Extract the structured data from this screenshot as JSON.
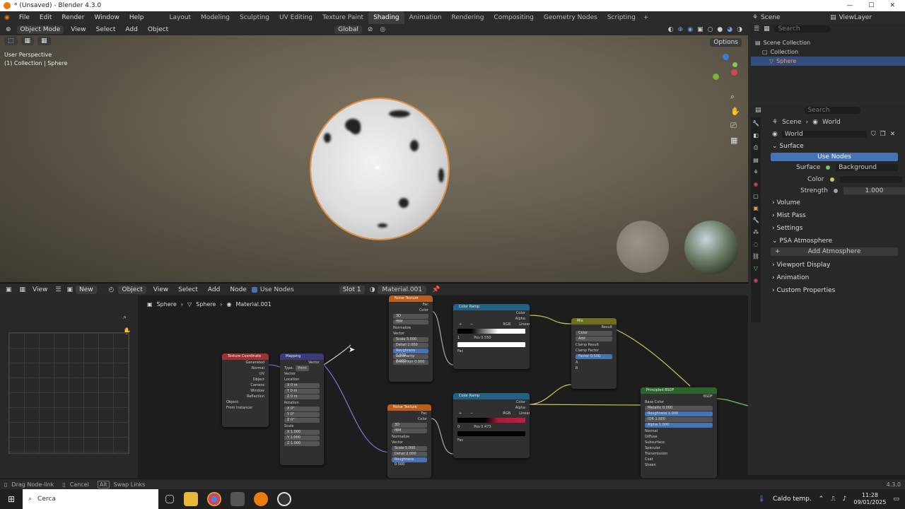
{
  "titlebar": {
    "title": "* (Unsaved) - Blender 4.3.0"
  },
  "menu": [
    "File",
    "Edit",
    "Render",
    "Window",
    "Help"
  ],
  "workspaces": [
    "Layout",
    "Modeling",
    "Sculpting",
    "UV Editing",
    "Texture Paint",
    "Shading",
    "Animation",
    "Rendering",
    "Compositing",
    "Geometry Nodes",
    "Scripting"
  ],
  "active_workspace": "Shading",
  "scene_name": "Scene",
  "view_layer": "ViewLayer",
  "viewport": {
    "mode": "Object Mode",
    "menus": [
      "View",
      "Select",
      "Add",
      "Object"
    ],
    "orientation": "Global",
    "overlay_line1": "User Perspective",
    "overlay_line2": "(1) Collection | Sphere",
    "options": "Options"
  },
  "outliner": {
    "search_placeholder": "Search",
    "items": [
      "Scene Collection",
      "Collection",
      "Sphere"
    ]
  },
  "properties": {
    "search_placeholder": "Search",
    "breadcrumb": [
      "Scene",
      "World"
    ],
    "world_name": "World",
    "surface_panel": "Surface",
    "use_nodes_label": "Use Nodes",
    "surface_label": "Surface",
    "surface_value": "Background",
    "color_label": "Color",
    "strength_label": "Strength",
    "strength_value": "1.000",
    "sections": [
      "Volume",
      "Mist Pass",
      "Settings",
      "PSA Atmosphere"
    ],
    "add_atmosphere": "Add Atmosphere",
    "sections2": [
      "Viewport Display",
      "Animation",
      "Custom Properties"
    ]
  },
  "node_header": {
    "view": "View",
    "new": "New",
    "object": "Object",
    "menus": [
      "View",
      "Select",
      "Add",
      "Node"
    ],
    "use_nodes": "Use Nodes",
    "slot": "Slot 1",
    "material": "Material.001"
  },
  "breadcrumb": [
    "Sphere",
    "Sphere",
    "Material.001"
  ],
  "nodes": {
    "tex_coord": {
      "title": "Texture Coordinate",
      "outputs": [
        "Generated",
        "Normal",
        "UV",
        "Object",
        "Camera",
        "Window",
        "Reflection"
      ],
      "object_label": "Object:",
      "from_instancer": "From Instancer"
    },
    "mapping": {
      "title": "Mapping",
      "output": "Vector",
      "type_label": "Type:",
      "type_value": "Point",
      "vector": "Vector",
      "location": "Location",
      "rotation": "Rotation",
      "scale": "Scale",
      "loc": [
        "X 0 m",
        "Y 0 m",
        "Z 0 m"
      ],
      "rot": [
        "X 0°",
        "Y 0°",
        "Z 0°"
      ],
      "scl": [
        "X 1.000",
        "Y 1.000",
        "Z 1.000"
      ]
    },
    "noise1": {
      "title": "Noise Texture",
      "outputs": [
        "Fac",
        "Color"
      ],
      "dim": "3D",
      "type": "fBM",
      "normalize": "Normalize",
      "vector": "Vector",
      "fields": [
        "Scale 5.000",
        "Detail 2.000",
        "Roughness 0.500",
        "Lacunarity 2.000",
        "Distortion 0.000"
      ]
    },
    "ramp1": {
      "title": "Color Ramp",
      "outputs": [
        "Color",
        "Alpha"
      ],
      "mode": "RGB",
      "interp": "Linear",
      "index": "1",
      "pos": "Pos 0.550",
      "fac": "Fac"
    },
    "mix": {
      "title": "Mix",
      "output": "Result",
      "type": "Color",
      "blend": "Add",
      "clamp_result": "Clamp Result",
      "clamp_factor": "Clamp Factor",
      "factor": "Factor 0.500",
      "a": "A",
      "b": "B"
    },
    "noise2": {
      "title": "Noise Texture",
      "outputs": [
        "Fac",
        "Color"
      ],
      "dim": "3D",
      "type": "fBM",
      "normalize": "Normalize",
      "vector": "Vector",
      "fields": [
        "Scale 5.000",
        "Detail 2.000",
        "Roughness 0.500"
      ]
    },
    "ramp2": {
      "title": "Color Ramp",
      "outputs": [
        "Color",
        "Alpha"
      ],
      "mode": "RGB",
      "interp": "Linear",
      "index": "0",
      "pos": "Pos 0.473",
      "fac": "Fac"
    },
    "bsdf": {
      "title": "Principled BSDF",
      "output": "BSDF",
      "rows": [
        "Base Color",
        "Metallic 0.000",
        "Roughness 1.000",
        "IOR 1.000",
        "Alpha 1.000",
        "Normal",
        "Diffuse",
        "Subsurface",
        "Specular",
        "Transmission",
        "Coat",
        "Sheen"
      ]
    }
  },
  "statusbar": {
    "left1": "Drag Node-link",
    "left2": "Cancel",
    "left3": "Swap Links",
    "version": "4.3.0"
  },
  "taskbar": {
    "search": "Cerca",
    "weather": "Caldo temp.",
    "time": "11:28",
    "date": "09/01/2025"
  },
  "colors": {
    "accent": "#4772b3",
    "selection": "#e58f3c",
    "node_input": "#9e3232",
    "node_texture": "#b95e1d",
    "node_converter": "#246283",
    "node_color": "#6e6e1d",
    "node_shader": "#2b652b",
    "node_vector": "#3b3b7a"
  }
}
